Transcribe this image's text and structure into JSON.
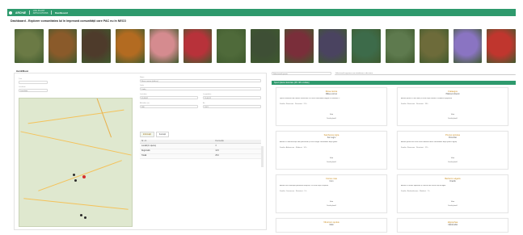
{
  "topbar": {
    "brand": "ARCHÆ",
    "unit_line1": "LIDL PLANT",
    "unit_line2": "APPLICATIONS",
    "nav_label": "Dashboard",
    "color": "#2e9a6d"
  },
  "page": {
    "title": "Dashboard - Explorer comunitatea lui în împreună comunității care PAC nu în NECO"
  },
  "thumbnails": [
    {
      "name": "thumb-1",
      "color": "#6b7a45"
    },
    {
      "name": "thumb-2",
      "color": "#8a5a2a"
    },
    {
      "name": "thumb-3",
      "color": "#4e3b2b"
    },
    {
      "name": "thumb-4",
      "color": "#b36b21"
    },
    {
      "name": "thumb-5",
      "color": "#d58b8f"
    },
    {
      "name": "thumb-6",
      "color": "#b8323a"
    },
    {
      "name": "thumb-7",
      "color": "#4f6a3a"
    },
    {
      "name": "thumb-8",
      "color": "#3e4f35"
    },
    {
      "name": "thumb-9",
      "color": "#7a2e3a"
    },
    {
      "name": "thumb-10",
      "color": "#4a4360"
    },
    {
      "name": "thumb-11",
      "color": "#3d6b4a"
    },
    {
      "name": "thumb-12",
      "color": "#5e7a4e"
    },
    {
      "name": "thumb-13",
      "color": "#6d6b3a"
    },
    {
      "name": "thumb-14",
      "color": "#8a74c2"
    },
    {
      "name": "thumb-15",
      "color": "#c0362e"
    }
  ],
  "section_label": "Hartă/Masă",
  "left": {
    "field1_label": "Țara",
    "field1_value": "",
    "field2_label": "Localitate",
    "field2_value": "Localitate",
    "detail": {
      "name_label": "Nume",
      "name_value": "Rosa canina (măceș)",
      "county_label": "Județ",
      "county_value": "Județ",
      "lat_label": "Latitudine",
      "lat_value": "45.8462",
      "lon_label": "Longitudine",
      "lon_value": "25.6612",
      "alt_label": "Altitudine (m)",
      "alt_value": "580",
      "year_label": "An",
      "year_value": "2021"
    },
    "tabs": [
      {
        "label": "Informații"
      },
      {
        "label": "Ilustrații"
      }
    ],
    "table": {
      "headers": [
        "Nr. crt.",
        "Frecvență"
      ],
      "rows": [
        [
          "Locală (în specie)",
          "3"
        ],
        [
          "Regională",
          "12.5"
        ],
        [
          "Totală",
          "25.0"
        ]
      ]
    }
  },
  "right": {
    "search_placeholder": "Selectează specia",
    "region_placeholder": "Selectează regiunea sau introduceți o descriere",
    "header": "Specii plante detectate (48 / 48 rezultate)",
    "cards": [
      {
        "title": "Rosa canina",
        "subtitle": "Măceș comun",
        "desc": "Specie arbustivă din familia Rosaceae cu fructe comestibile bogate în vitamina C",
        "meta": "Familie: Rosaceae · Rezistent · 21 h",
        "btn": "Vezi",
        "btn_label": "Detalii plantă"
      },
      {
        "title": "Crataegus",
        "subtitle": "Păducel obișnuit",
        "desc": "Arbust spinos cu flori albe și fructe roșii folosite în medicina populară",
        "meta": "Familie: Rosaceae · Rezistent · 18 h",
        "btn": "Vezi",
        "btn_label": "Detalii plantă"
      },
      {
        "title": "Sambucus nigra",
        "subtitle": "Soc negru",
        "desc": "Arbust cu inflorescențe albe parfumate și fructe negre comestibile după gătire",
        "meta": "Familie: Adoxaceae · Moderat · 14 h",
        "btn": "Vezi",
        "btn_label": "Detalii plantă"
      },
      {
        "title": "Prunus spinosa",
        "subtitle": "Porumbar",
        "desc": "Arbust spinos ale cărui fructe albastre devin comestibile după primul îngheț",
        "meta": "Familie: Rosaceae · Rezistent · 12 h",
        "btn": "Vezi",
        "btn_label": "Detalii plantă"
      },
      {
        "title": "Cornus mas",
        "subtitle": "Corn",
        "desc": "Arbust care înflorește primăvara timpuriu, cu fructe roșii acrișoare",
        "meta": "Familie: Cornaceae · Rezistent · 9 h",
        "btn": "Vezi",
        "btn_label": "Detalii plantă"
      },
      {
        "title": "Berberis vulgaris",
        "subtitle": "Dracilă",
        "desc": "Arbust cu ramuri spinoase și ciorchini de fructe roșii alungite",
        "meta": "Familie: Berberidaceae · Moderat · 7 h",
        "btn": "Vezi",
        "btn_label": "Detalii plantă"
      },
      {
        "title": "Viburnum opulus",
        "subtitle": "Călin",
        "desc": "",
        "meta": "",
        "btn": "",
        "btn_label": ""
      },
      {
        "title": "Hippophae",
        "subtitle": "Cătină albă",
        "desc": "",
        "meta": "",
        "btn": "",
        "btn_label": ""
      }
    ]
  },
  "map_markers": [
    {
      "kind": "red"
    },
    {
      "kind": "dark"
    },
    {
      "kind": "dark"
    },
    {
      "kind": "dark"
    },
    {
      "kind": "dark"
    }
  ]
}
